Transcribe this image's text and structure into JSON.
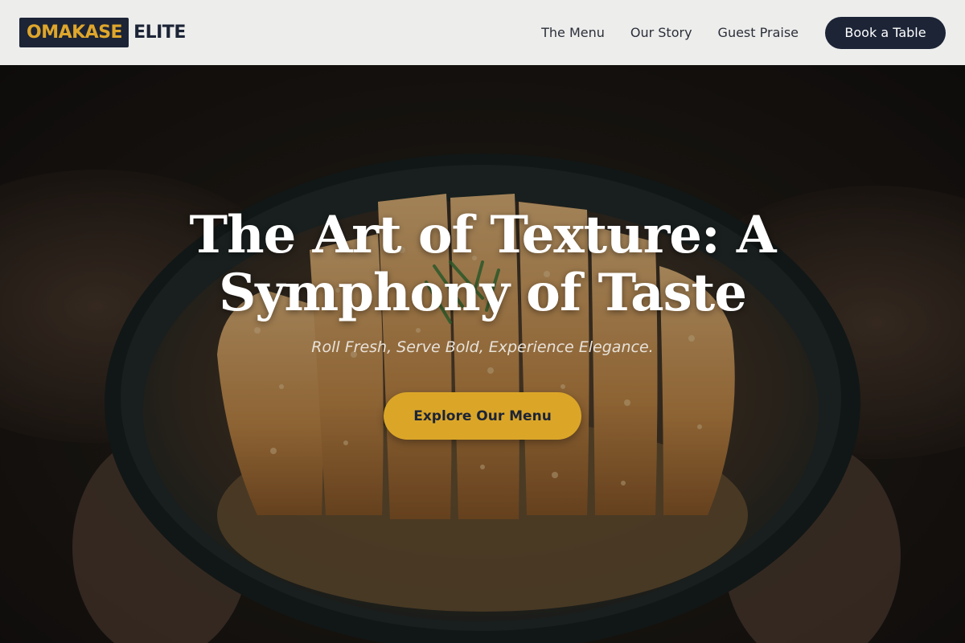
{
  "header": {
    "logo_highlight": "OMAKASE",
    "logo_rest": "ELITE",
    "nav": [
      {
        "label": "The Menu"
      },
      {
        "label": "Our Story"
      },
      {
        "label": "Guest Praise"
      }
    ],
    "cta_label": "Book a Table"
  },
  "hero": {
    "title": "The Art of Texture: A Symphony of Taste",
    "tagline": "Roll Fresh, Serve Bold, Experience Elegance.",
    "cta_label": "Explore Our Menu"
  },
  "colors": {
    "brand_dark": "#1c2436",
    "accent_gold": "#dba628",
    "header_bg": "#ededec"
  }
}
